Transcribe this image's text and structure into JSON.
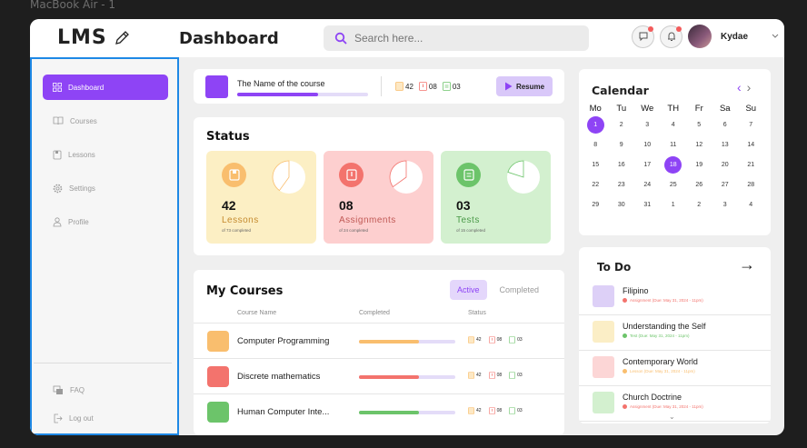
{
  "frame_label": "MacBook Air - 1",
  "colors": {
    "accent": "#8e44f5",
    "lessons": "#f9be6e",
    "assignments": "#f3736d",
    "tests": "#6cc46a"
  },
  "header": {
    "logo": "LMS",
    "logo_icon": "pencil-icon",
    "title": "Dashboard",
    "search_placeholder": "Search here...",
    "username": "Kydae"
  },
  "sidebar": {
    "items": [
      {
        "label": "Dashboard",
        "icon": "grid-icon"
      },
      {
        "label": "Courses",
        "icon": "book-icon"
      },
      {
        "label": "Lessons",
        "icon": "lesson-icon"
      },
      {
        "label": "Settings",
        "icon": "gear-icon"
      },
      {
        "label": "Profile",
        "icon": "user-icon"
      }
    ],
    "bottom": [
      {
        "label": "FAQ",
        "icon": "faq-icon"
      },
      {
        "label": "Log out",
        "icon": "logout-icon"
      }
    ]
  },
  "current_course": {
    "name": "The Name of the course",
    "progress": 0.62,
    "lessons": "42",
    "assignments": "08",
    "tests": "03",
    "resume_label": "Resume"
  },
  "status": {
    "title": "Status",
    "cards": [
      {
        "count": "42",
        "label": "Lessons",
        "sub": "of 73 completed",
        "fraction": 0.6
      },
      {
        "count": "08",
        "label": "Assignments",
        "sub": "of 24 completed",
        "fraction": 0.65
      },
      {
        "count": "03",
        "label": "Tests",
        "sub": "of 15 completed",
        "fraction": 0.8
      }
    ]
  },
  "courses": {
    "title": "My Courses",
    "tab_active": "Active",
    "tab_completed": "Completed",
    "headers": [
      "Course Name",
      "Completed",
      "Status"
    ],
    "rows": [
      {
        "name": "Computer Programming",
        "progress": 0.62,
        "lessons": "42",
        "assignments": "08",
        "tests": "03"
      },
      {
        "name": "Discrete mathematics",
        "progress": 0.62,
        "lessons": "42",
        "assignments": "08",
        "tests": "03"
      },
      {
        "name": "Human Computer Inte...",
        "progress": 0.62,
        "lessons": "42",
        "assignments": "08",
        "tests": "03"
      }
    ]
  },
  "calendar": {
    "title": "Calendar",
    "weekdays": [
      "Mo",
      "Tu",
      "We",
      "TH",
      "Fr",
      "Sa",
      "Su"
    ],
    "days": [
      "1",
      "2",
      "3",
      "4",
      "5",
      "6",
      "7",
      "8",
      "9",
      "10",
      "11",
      "12",
      "13",
      "14",
      "15",
      "16",
      "17",
      "18",
      "19",
      "20",
      "21",
      "22",
      "23",
      "24",
      "25",
      "26",
      "27",
      "28",
      "29",
      "30",
      "31",
      "1",
      "2",
      "3",
      "4"
    ],
    "selected": [
      0,
      17
    ]
  },
  "todo": {
    "title": "To Do",
    "items": [
      {
        "name": "Filipino",
        "sub": "Assignment (Due: May 31, 2024 - 11pm)",
        "thumb": "#ddd0f7",
        "dot": "#f3736d"
      },
      {
        "name": "Understanding the Self",
        "sub": "Test (Due: May 31, 2024 - 11pm)",
        "thumb": "#fbeec6",
        "dot": "#6cc46a"
      },
      {
        "name": "Contemporary World",
        "sub": "Lesson (Due: May 31, 2024 - 11pm)",
        "thumb": "#fcd6d6",
        "dot": "#f9be6e"
      },
      {
        "name": "Church Doctrine",
        "sub": "Assignment (Due: May 31, 2024 - 11pm)",
        "thumb": "#d3f0cf",
        "dot": "#f3736d"
      }
    ]
  }
}
